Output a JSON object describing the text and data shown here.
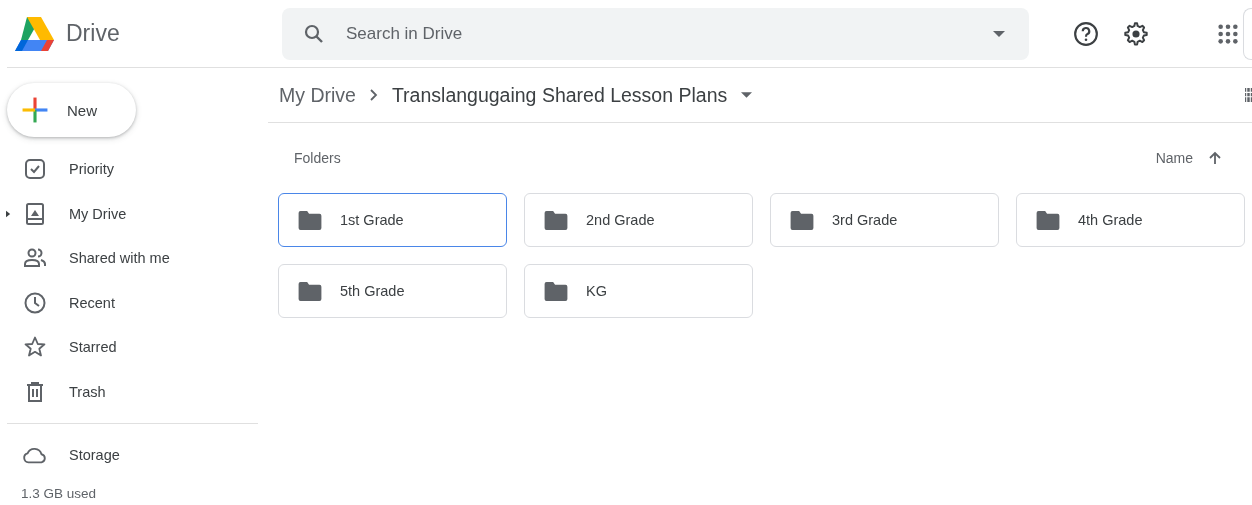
{
  "app": {
    "name": "Drive"
  },
  "search": {
    "placeholder": "Search in Drive"
  },
  "new_button": {
    "label": "New"
  },
  "sidebar": {
    "items": [
      {
        "label": "Priority"
      },
      {
        "label": "My Drive",
        "expanded": false
      },
      {
        "label": "Shared with me"
      },
      {
        "label": "Recent"
      },
      {
        "label": "Starred"
      },
      {
        "label": "Trash"
      }
    ],
    "storage": {
      "label": "Storage",
      "usage": "1.3 GB used"
    }
  },
  "breadcrumb": [
    "My Drive",
    "Translangugaing Shared Lesson Plans"
  ],
  "section_title": "Folders",
  "sort": {
    "label": "Name"
  },
  "folders": [
    {
      "name": "1st Grade",
      "selected": true
    },
    {
      "name": "2nd Grade",
      "selected": false
    },
    {
      "name": "3rd Grade",
      "selected": false
    },
    {
      "name": "4th Grade",
      "selected": false
    },
    {
      "name": "5th Grade",
      "selected": false
    },
    {
      "name": "KG",
      "selected": false
    }
  ]
}
